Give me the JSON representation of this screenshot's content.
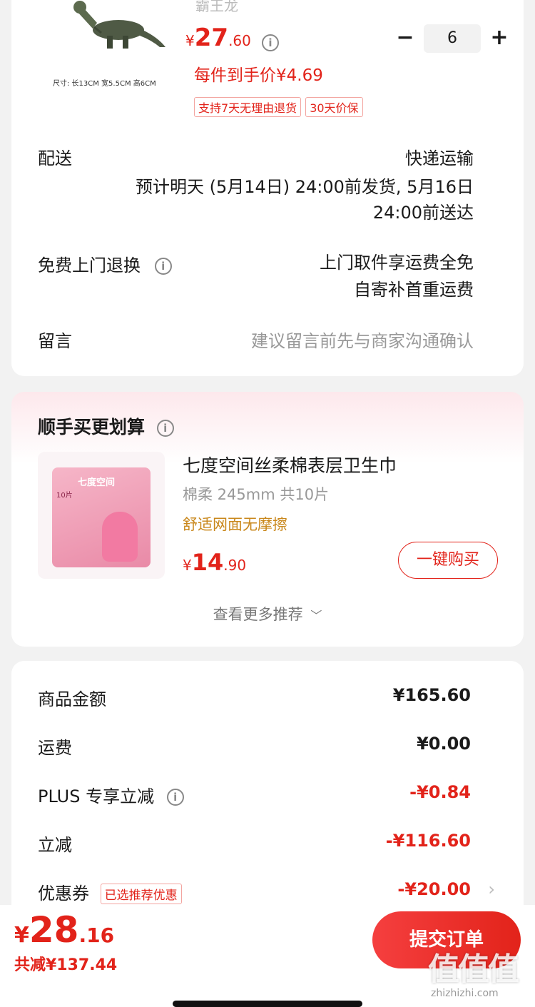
{
  "product": {
    "name_partial": "霸王龙",
    "size_label": "尺寸: 长13CM 宽5.5CM 高6CM",
    "price_symbol": "¥",
    "price_int": "27",
    "price_dec": ".60",
    "unit_price": "每件到手价¥4.69",
    "quantity": "6",
    "minus": "−",
    "plus": "+",
    "badges": [
      "支持7天无理由退货",
      "30天价保"
    ]
  },
  "delivery": {
    "label": "配送",
    "method": "快递运输",
    "line1": "预计明天 (5月14日) 24:00前发货, 5月16日",
    "line2": "24:00前送达"
  },
  "return": {
    "label": "免费上门退换",
    "line1": "上门取件享运费全免",
    "line2": "自寄补首重运费"
  },
  "message": {
    "label": "留言",
    "placeholder": "建议留言前先与商家沟通确认"
  },
  "recommend": {
    "title": "顺手买更划算",
    "product_name": "七度空间丝柔棉表层卫生巾",
    "spec": "棉柔 245mm 共10片",
    "feature": "舒适网面无摩擦",
    "price_symbol": "¥",
    "price_int": "14",
    "price_dec": ".90",
    "buy_label": "一键购买",
    "more_label": "查看更多推荐",
    "pack_brand": "七度空间",
    "pack_count": "10片"
  },
  "summary": {
    "rows": [
      {
        "label": "商品金额",
        "value": "¥165.60"
      },
      {
        "label": "运费",
        "value": "¥0.00"
      },
      {
        "label": "PLUS 专享立减",
        "value": "-¥0.84"
      },
      {
        "label": "立减",
        "value": "-¥116.60"
      },
      {
        "label": "优惠券",
        "value": "-¥20.00",
        "tag": "已选推荐优惠"
      }
    ]
  },
  "footer": {
    "total_symbol": "¥",
    "total_int": "28",
    "total_dec": ".16",
    "saved": "共减¥137.44",
    "submit_label": "提交订单",
    "watermark": "值值值",
    "watermark_url": "zhizhizhi.com"
  },
  "colors": {
    "accent": "#e2231a",
    "orange": "#c9871b"
  }
}
